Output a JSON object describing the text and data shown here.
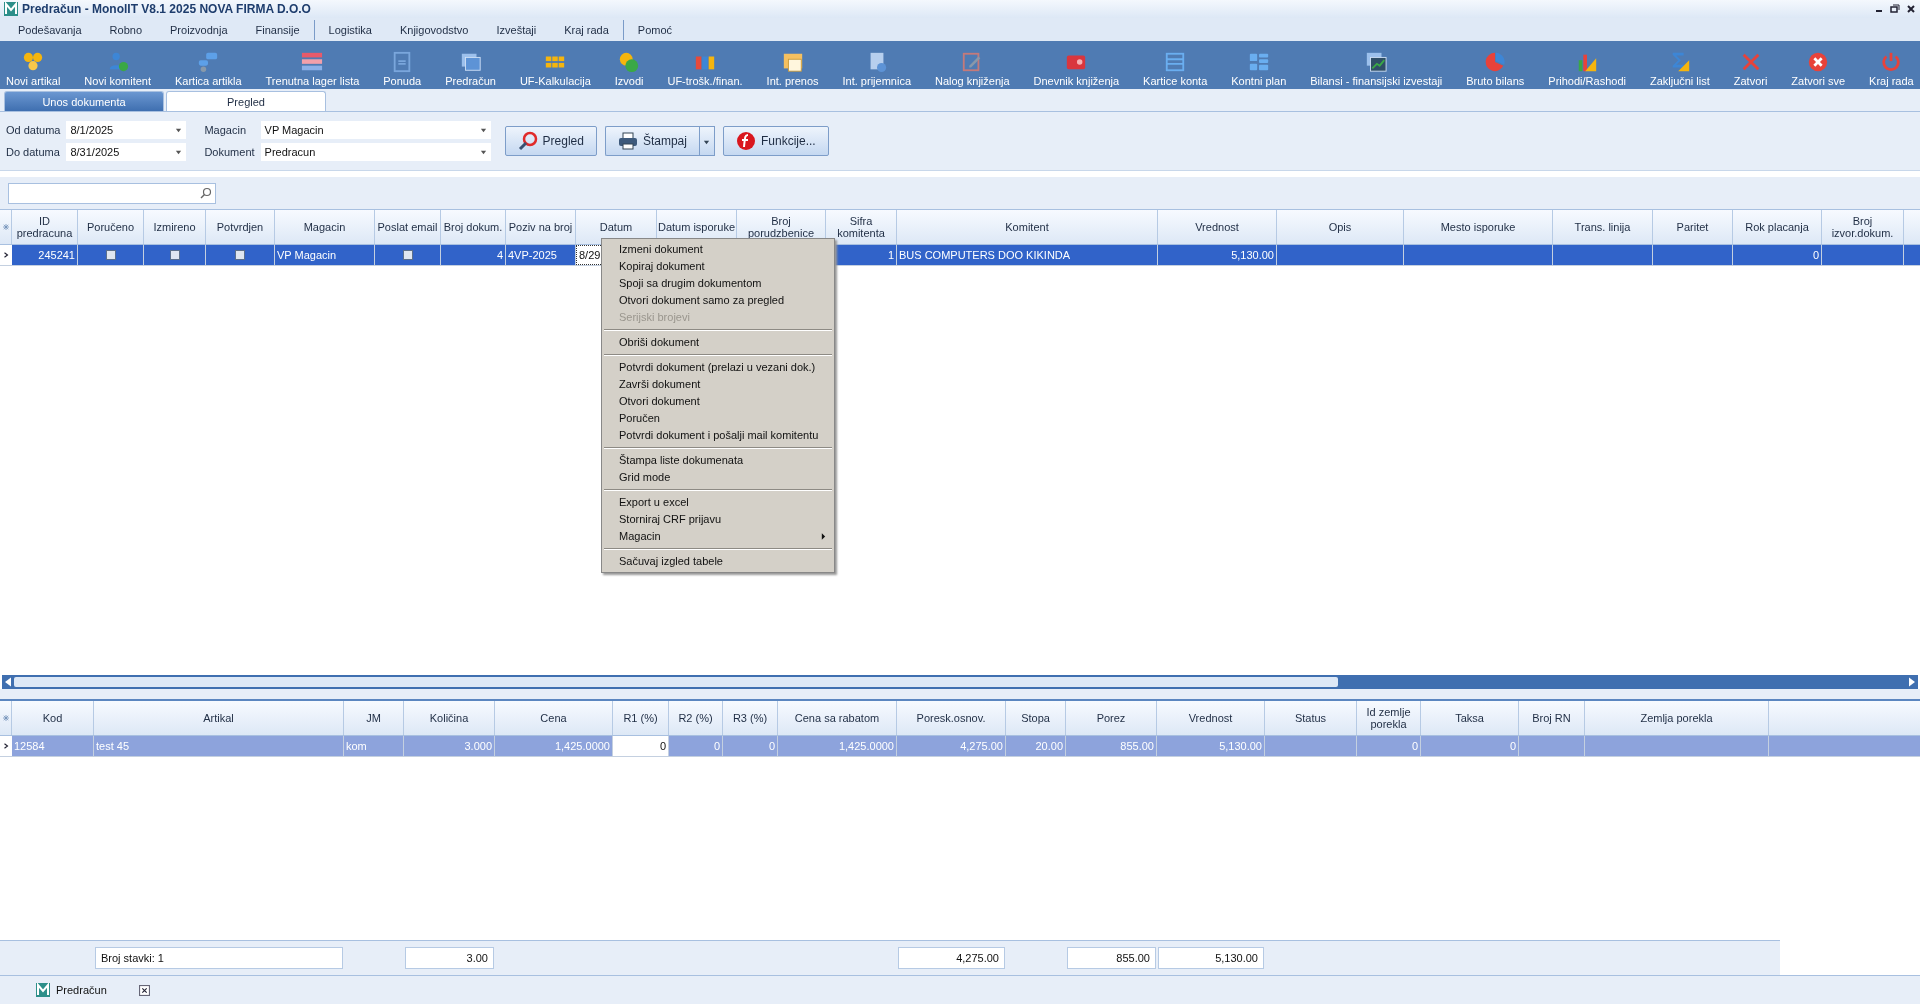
{
  "window": {
    "title": "Predračun - MonolIT V8.1 2025 NOVA FIRMA D.O.O"
  },
  "menu": [
    [
      "Podešavanja",
      "Robno",
      "Proizvodnja",
      "Finansije"
    ],
    [
      "Logistika",
      "Knjigovodstvo",
      "Izveštaji",
      "Kraj rada"
    ],
    [
      "Pomoć"
    ]
  ],
  "toolbar": [
    "Novi artikal",
    "Novi komitent",
    "Kartica artikla",
    "Trenutna lager lista",
    "Ponuda",
    "Predračun",
    "UF-Kalkulacija",
    "Izvodi",
    "UF-trošk./finan.",
    "Int. prenos",
    "Int. prijemnica",
    "Nalog knjiženja",
    "Dnevnik knjiženja",
    "Kartice konta",
    "Kontni plan",
    "Bilansi - finansijski izvestaji",
    "Bruto bilans",
    "Prihodi/Rashodi",
    "Zaključni list",
    "Zatvori",
    "Zatvori sve",
    "Kraj rada"
  ],
  "tabs": [
    {
      "label": "Unos dokumenta",
      "selected": false
    },
    {
      "label": "Pregled",
      "selected": true
    }
  ],
  "filters": [
    {
      "label": "Od datuma",
      "value": "8/1/2025"
    },
    {
      "label": "Do datuma",
      "value": "8/31/2025"
    },
    {
      "label": "Magacin",
      "value": "VP Magacin"
    },
    {
      "label": "Dokument",
      "value": "Predracun"
    }
  ],
  "buttons": [
    "Pregled",
    "Štampaj",
    "Funkcije..."
  ],
  "top_table": {
    "columns": [
      "ID predracuna",
      "Poručeno",
      "Izmireno",
      "Potvrdjen",
      "Magacin",
      "Poslat email",
      "Broj dokum.",
      "Poziv na broj",
      "Datum",
      "Datum isporuke",
      "Broj porudzbenice",
      "Sifra komitenta",
      "Komitent",
      "Vrednost",
      "Opis",
      "Mesto isporuke",
      "Trans. linija",
      "Paritet",
      "Rok placanja",
      "Broj izvor.dokum."
    ],
    "rows": [
      {
        "selected": true,
        "id": "245241",
        "poruceno": false,
        "izmireno": false,
        "potvrdjen": false,
        "magacin": "VP Magacin",
        "poslat_email": false,
        "broj_dokum": "4",
        "poziv_na_broj": "4VP-2025",
        "datum": "8/29",
        "sifra_komitenta": "1",
        "komitent": "BUS COMPUTERS DOO KIKINDA",
        "vrednost": "5,130.00",
        "rok_placanja": "0"
      }
    ]
  },
  "context_menu": [
    [
      {
        "label": "Izmeni dokument",
        "disabled": false,
        "submenu": false
      },
      {
        "label": "Kopiraj dokument",
        "disabled": false,
        "submenu": false
      },
      {
        "label": "Spoji sa drugim dokumentom",
        "disabled": false,
        "submenu": false
      },
      {
        "label": "Otvori dokument samo za pregled",
        "disabled": false,
        "submenu": false
      },
      {
        "label": "Serijski brojevi",
        "disabled": true,
        "submenu": false
      }
    ],
    [
      {
        "label": "Obriši dokument",
        "disabled": false,
        "submenu": false
      }
    ],
    [
      {
        "label": "Potvrdi dokument (prelazi u vezani dok.)",
        "disabled": false,
        "submenu": false
      },
      {
        "label": "Završi dokument",
        "disabled": false,
        "submenu": false
      },
      {
        "label": "Otvori dokument",
        "disabled": false,
        "submenu": false
      },
      {
        "label": "Poručen",
        "disabled": false,
        "submenu": false
      },
      {
        "label": "Potvrdi dokument i pošalji mail komitentu",
        "disabled": false,
        "submenu": false
      }
    ],
    [
      {
        "label": "Štampa liste dokumenata",
        "disabled": false,
        "submenu": false
      },
      {
        "label": "Grid mode",
        "disabled": false,
        "submenu": false
      }
    ],
    [
      {
        "label": "Export u excel",
        "disabled": false,
        "submenu": false
      },
      {
        "label": "Storniraj CRF prijavu",
        "disabled": false,
        "submenu": false
      },
      {
        "label": "Magacin",
        "disabled": false,
        "submenu": true
      }
    ],
    [
      {
        "label": "Sačuvaj izgled tabele",
        "disabled": false,
        "submenu": false
      }
    ]
  ],
  "bottom_table": {
    "columns": [
      "Kod",
      "Artikal",
      "JM",
      "Količina",
      "Cena",
      "R1 (%)",
      "R2 (%)",
      "R3 (%)",
      "Cena sa rabatom",
      "Poresk.osnov.",
      "Stopa",
      "Porez",
      "Vrednost",
      "Status",
      "Id zemlje porekla",
      "Taksa",
      "Broj RN",
      "Zemlja porekla"
    ],
    "rows": [
      {
        "selected": true,
        "kod": "12584",
        "artikal": "test 45",
        "jm": "kom",
        "kolicina": "3.000",
        "cena": "1,425.0000",
        "r1": "0",
        "r2": "0",
        "r3": "0",
        "cena_sa_rabatom": "1,425.0000",
        "poresk_osnov": "4,275.00",
        "stopa": "20.00",
        "porez": "855.00",
        "vrednost": "5,130.00",
        "id_zemlje_porekla": "0",
        "taksa": "0"
      }
    ],
    "footer": {
      "broj_stavki": "Broj stavki: 1",
      "kolicina": "3.00",
      "poresk_osnov": "4,275.00",
      "porez": "855.00",
      "vrednost": "5,130.00"
    }
  },
  "taskbar": [
    {
      "label": "Predračun"
    }
  ]
}
